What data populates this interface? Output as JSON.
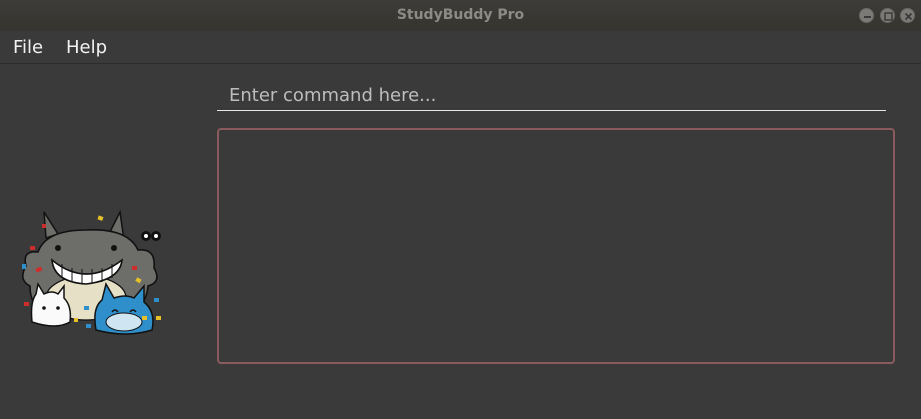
{
  "window": {
    "title": "StudyBuddy Pro"
  },
  "menu": {
    "file": "File",
    "help": "Help"
  },
  "command": {
    "placeholder": "Enter command here...",
    "value": ""
  },
  "result": {
    "text": ""
  },
  "colors": {
    "result_border": "#8a5a5e",
    "background": "#3a3a3a"
  },
  "mascot": {
    "icon": "totoro-mascot-icon"
  }
}
